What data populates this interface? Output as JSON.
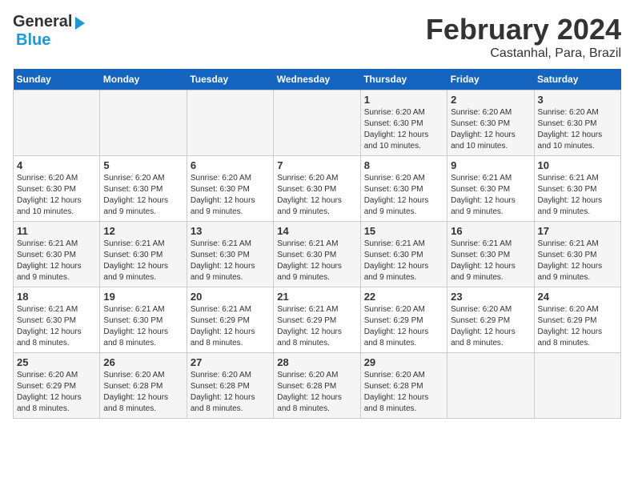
{
  "logo": {
    "general": "General",
    "blue": "Blue"
  },
  "title": "February 2024",
  "subtitle": "Castanhal, Para, Brazil",
  "days_of_week": [
    "Sunday",
    "Monday",
    "Tuesday",
    "Wednesday",
    "Thursday",
    "Friday",
    "Saturday"
  ],
  "weeks": [
    [
      {
        "num": "",
        "info": ""
      },
      {
        "num": "",
        "info": ""
      },
      {
        "num": "",
        "info": ""
      },
      {
        "num": "",
        "info": ""
      },
      {
        "num": "1",
        "info": "Sunrise: 6:20 AM\nSunset: 6:30 PM\nDaylight: 12 hours\nand 10 minutes."
      },
      {
        "num": "2",
        "info": "Sunrise: 6:20 AM\nSunset: 6:30 PM\nDaylight: 12 hours\nand 10 minutes."
      },
      {
        "num": "3",
        "info": "Sunrise: 6:20 AM\nSunset: 6:30 PM\nDaylight: 12 hours\nand 10 minutes."
      }
    ],
    [
      {
        "num": "4",
        "info": "Sunrise: 6:20 AM\nSunset: 6:30 PM\nDaylight: 12 hours\nand 10 minutes."
      },
      {
        "num": "5",
        "info": "Sunrise: 6:20 AM\nSunset: 6:30 PM\nDaylight: 12 hours\nand 9 minutes."
      },
      {
        "num": "6",
        "info": "Sunrise: 6:20 AM\nSunset: 6:30 PM\nDaylight: 12 hours\nand 9 minutes."
      },
      {
        "num": "7",
        "info": "Sunrise: 6:20 AM\nSunset: 6:30 PM\nDaylight: 12 hours\nand 9 minutes."
      },
      {
        "num": "8",
        "info": "Sunrise: 6:20 AM\nSunset: 6:30 PM\nDaylight: 12 hours\nand 9 minutes."
      },
      {
        "num": "9",
        "info": "Sunrise: 6:21 AM\nSunset: 6:30 PM\nDaylight: 12 hours\nand 9 minutes."
      },
      {
        "num": "10",
        "info": "Sunrise: 6:21 AM\nSunset: 6:30 PM\nDaylight: 12 hours\nand 9 minutes."
      }
    ],
    [
      {
        "num": "11",
        "info": "Sunrise: 6:21 AM\nSunset: 6:30 PM\nDaylight: 12 hours\nand 9 minutes."
      },
      {
        "num": "12",
        "info": "Sunrise: 6:21 AM\nSunset: 6:30 PM\nDaylight: 12 hours\nand 9 minutes."
      },
      {
        "num": "13",
        "info": "Sunrise: 6:21 AM\nSunset: 6:30 PM\nDaylight: 12 hours\nand 9 minutes."
      },
      {
        "num": "14",
        "info": "Sunrise: 6:21 AM\nSunset: 6:30 PM\nDaylight: 12 hours\nand 9 minutes."
      },
      {
        "num": "15",
        "info": "Sunrise: 6:21 AM\nSunset: 6:30 PM\nDaylight: 12 hours\nand 9 minutes."
      },
      {
        "num": "16",
        "info": "Sunrise: 6:21 AM\nSunset: 6:30 PM\nDaylight: 12 hours\nand 9 minutes."
      },
      {
        "num": "17",
        "info": "Sunrise: 6:21 AM\nSunset: 6:30 PM\nDaylight: 12 hours\nand 9 minutes."
      }
    ],
    [
      {
        "num": "18",
        "info": "Sunrise: 6:21 AM\nSunset: 6:30 PM\nDaylight: 12 hours\nand 8 minutes."
      },
      {
        "num": "19",
        "info": "Sunrise: 6:21 AM\nSunset: 6:30 PM\nDaylight: 12 hours\nand 8 minutes."
      },
      {
        "num": "20",
        "info": "Sunrise: 6:21 AM\nSunset: 6:29 PM\nDaylight: 12 hours\nand 8 minutes."
      },
      {
        "num": "21",
        "info": "Sunrise: 6:21 AM\nSunset: 6:29 PM\nDaylight: 12 hours\nand 8 minutes."
      },
      {
        "num": "22",
        "info": "Sunrise: 6:20 AM\nSunset: 6:29 PM\nDaylight: 12 hours\nand 8 minutes."
      },
      {
        "num": "23",
        "info": "Sunrise: 6:20 AM\nSunset: 6:29 PM\nDaylight: 12 hours\nand 8 minutes."
      },
      {
        "num": "24",
        "info": "Sunrise: 6:20 AM\nSunset: 6:29 PM\nDaylight: 12 hours\nand 8 minutes."
      }
    ],
    [
      {
        "num": "25",
        "info": "Sunrise: 6:20 AM\nSunset: 6:29 PM\nDaylight: 12 hours\nand 8 minutes."
      },
      {
        "num": "26",
        "info": "Sunrise: 6:20 AM\nSunset: 6:28 PM\nDaylight: 12 hours\nand 8 minutes."
      },
      {
        "num": "27",
        "info": "Sunrise: 6:20 AM\nSunset: 6:28 PM\nDaylight: 12 hours\nand 8 minutes."
      },
      {
        "num": "28",
        "info": "Sunrise: 6:20 AM\nSunset: 6:28 PM\nDaylight: 12 hours\nand 8 minutes."
      },
      {
        "num": "29",
        "info": "Sunrise: 6:20 AM\nSunset: 6:28 PM\nDaylight: 12 hours\nand 8 minutes."
      },
      {
        "num": "",
        "info": ""
      },
      {
        "num": "",
        "info": ""
      }
    ]
  ]
}
